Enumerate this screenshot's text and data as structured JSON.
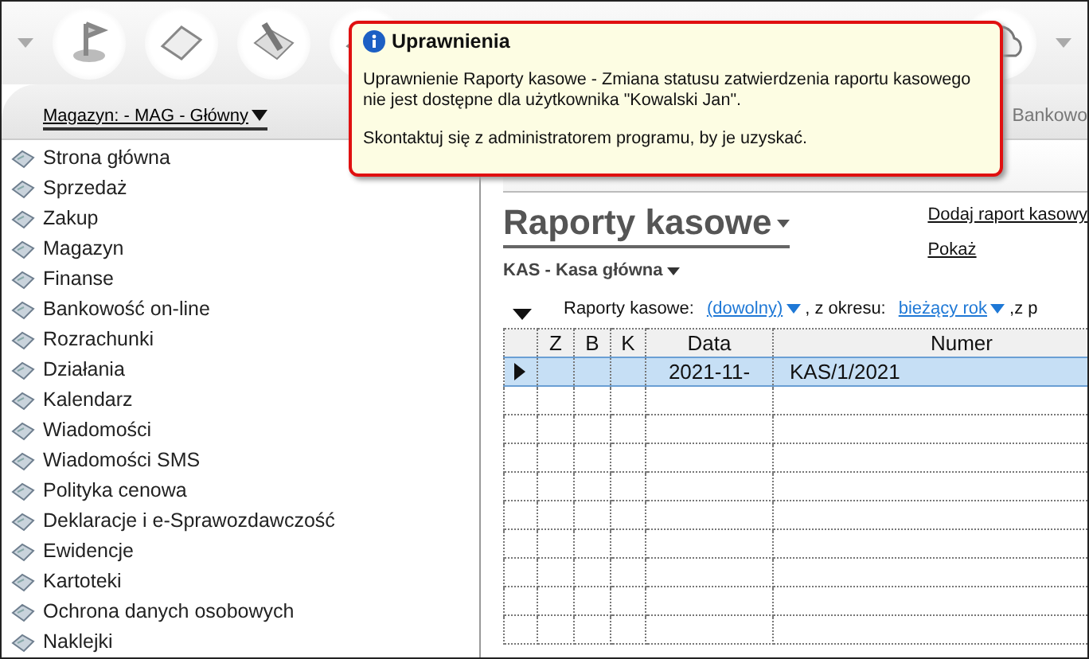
{
  "location_bar": {
    "warehouse": "Magazyn: - MAG - Główny",
    "tabs": [
      {
        "label": "Bankowo",
        "selected": false
      }
    ]
  },
  "sidebar": {
    "items": [
      {
        "label": "Strona główna"
      },
      {
        "label": "Sprzedaż"
      },
      {
        "label": "Zakup"
      },
      {
        "label": "Magazyn"
      },
      {
        "label": "Finanse"
      },
      {
        "label": "Bankowość on-line"
      },
      {
        "label": "Rozrachunki"
      },
      {
        "label": "Działania"
      },
      {
        "label": "Kalendarz"
      },
      {
        "label": "Wiadomości"
      },
      {
        "label": "Wiadomości SMS"
      },
      {
        "label": "Polityka cenowa"
      },
      {
        "label": "Deklaracje i e-Sprawozdawczość"
      },
      {
        "label": "Ewidencje"
      },
      {
        "label": "Kartoteki"
      },
      {
        "label": "Ochrona danych osobowych"
      },
      {
        "label": "Naklejki"
      }
    ]
  },
  "content": {
    "title": "Raporty kasowe",
    "register": "KAS - Kasa główna",
    "actions": [
      "Dodaj raport kasowy",
      "Pokaż"
    ],
    "filter": [
      {
        "kind": "text",
        "text": "Raporty kasowe:"
      },
      {
        "kind": "link",
        "text": "(dowolny)"
      },
      {
        "kind": "text",
        "text": ", z okresu:"
      },
      {
        "kind": "link",
        "text": "bieżący rok"
      },
      {
        "kind": "text",
        "text": ",z p"
      }
    ],
    "table": {
      "columns": [
        "Z",
        "B",
        "K",
        "Data",
        "Numer"
      ],
      "rows": [
        {
          "selected": true,
          "cells": {
            "data": "2021-11-",
            "numer": "KAS/1/2021"
          }
        }
      ]
    }
  },
  "tooltip": {
    "title": "Uprawnienia",
    "message": "Uprawnienie Raporty kasowe - Zmiana statusu zatwierdzenia raportu kasowego\nnie jest dostępne dla użytkownika \"Kowalski Jan\".",
    "hint": "Skontaktuj się z administratorem programu, by je uzyskać."
  }
}
